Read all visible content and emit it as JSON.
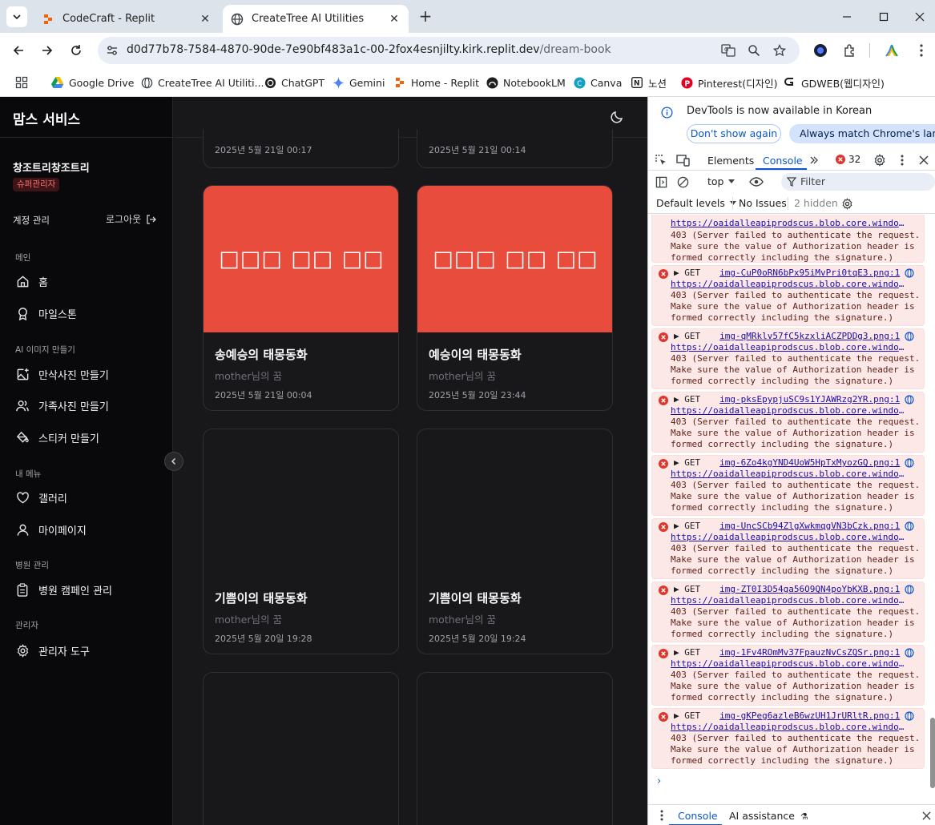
{
  "browser": {
    "tabs": [
      {
        "title": "CodeCraft - Replit",
        "active": false
      },
      {
        "title": "CreateTree AI Utilities",
        "active": true
      }
    ],
    "url_host": "d0d77b78-7584-4870-90de-7e90bf483a1c-00-2fox4esnjilty.kirk.replit.dev",
    "url_path": "/dream-book",
    "bookmarks": [
      "Google Drive",
      "CreateTree AI Utiliti...",
      "ChatGPT",
      "Gemini",
      "Home - Replit",
      "NotebookLM",
      "Canva",
      "노션",
      "Pinterest(디자인)",
      "GDWEB(웹디자인)"
    ]
  },
  "sidebar": {
    "brand": "맘스 서비스",
    "user_name": "창조트리창조트리",
    "role_badge": "슈퍼관리자",
    "account_label": "계정 관리",
    "logout_label": "로그아웃",
    "sections": {
      "main": "메인",
      "ai": "AI 이미지 만들기",
      "my": "내 메뉴",
      "hospital": "병원 관리",
      "admin": "관리자"
    },
    "items": {
      "home": "홈",
      "milestone": "마일스톤",
      "maternity": "만삭사진 만들기",
      "family": "가족사진 만들기",
      "sticker": "스티커 만들기",
      "gallery": "갤러리",
      "mypage": "마이페이지",
      "campaign": "병원 캠페인 관리",
      "admin_tools": "관리자 도구"
    }
  },
  "cards": {
    "top_left_date": "2025년 5월 21일 00:17",
    "top_right_date": "2025년 5월 21일 00:14",
    "items": [
      {
        "image_text": "□□□ □□ □□",
        "title": "송예승의 태몽동화",
        "subtitle": "mother님의 꿈",
        "date": "2025년 5월 21일 00:04"
      },
      {
        "image_text": "□□□ □□ □□",
        "title": "예승이의 태몽동화",
        "subtitle": "mother님의 꿈",
        "date": "2025년 5월 20일 23:44"
      },
      {
        "title": "기쁨이의 태몽동화",
        "subtitle": "mother님의 꿈",
        "date": "2025년 5월 20일 19:28"
      },
      {
        "title": "기쁨이의 태몽동화",
        "subtitle": "mother님의 꿈",
        "date": "2025년 5월 20일 19:24"
      }
    ],
    "image_color": "#e74c3c"
  },
  "devtools": {
    "info_message": "DevTools is now available in Korean",
    "dont_show": "Don't show again",
    "always_match": "Always match Chrome's language",
    "tab_elements": "Elements",
    "tab_console": "Console",
    "error_count": "32",
    "context": "top",
    "filter_placeholder": "Filter",
    "default_levels": "Default levels",
    "no_issues": "No Issues",
    "hidden": "2 hidden",
    "bottom_console": "Console",
    "bottom_ai": "AI assistance",
    "partial_entry": {
      "url": "https://oaidalleapiprodscus.blob.core.windows.n…",
      "msg1": "403 (Server failed to authenticate the request.",
      "msg2": "Make sure the value of Authorization header is",
      "msg3": "formed correctly including the signature.)"
    },
    "entries": [
      {
        "method": "▶ GET",
        "file": "img-CuP0oRN6bPx95iMvPri0tqE3.png:1",
        "url": "https://oaidalleapiprodscus.blob.core.windows.n…",
        "msg1": "403 (Server failed to authenticate the request.",
        "msg2": "Make sure the value of Authorization header is",
        "msg3": "formed correctly including the signature.)"
      },
      {
        "method": "▶ GET",
        "file": "img-qMRklv57fC5kzxliACZPDDg3.png:1",
        "url": "https://oaidalleapiprodscus.blob.core.windows.n…",
        "msg1": "403 (Server failed to authenticate the request.",
        "msg2": "Make sure the value of Authorization header is",
        "msg3": "formed correctly including the signature.)"
      },
      {
        "method": "▶ GET",
        "file": "img-pksEpypjuSC9s1YJAWRzg2YR.png:1",
        "url": "https://oaidalleapiprodscus.blob.core.windows.n…",
        "msg1": "403 (Server failed to authenticate the request.",
        "msg2": "Make sure the value of Authorization header is",
        "msg3": "formed correctly including the signature.)"
      },
      {
        "method": "▶ GET",
        "file": "img-6Zo4kgYND4UoW5HpTxMyozGQ.png:1",
        "url": "https://oaidalleapiprodscus.blob.core.windows.n…",
        "msg1": "403 (Server failed to authenticate the request.",
        "msg2": "Make sure the value of Authorization header is",
        "msg3": "formed correctly including the signature.)"
      },
      {
        "method": "▶ GET",
        "file": "img-UncSCb94ZlgXwkmqgVN3bCzk.png:1",
        "url": "https://oaidalleapiprodscus.blob.core.windows.n…",
        "msg1": "403 (Server failed to authenticate the request.",
        "msg2": "Make sure the value of Authorization header is",
        "msg3": "formed correctly including the signature.)"
      },
      {
        "method": "▶ GET",
        "file": "img-ZT0I3D54ga56O9QN4poYbKXB.png:1",
        "url": "https://oaidalleapiprodscus.blob.core.windows.n…",
        "msg1": "403 (Server failed to authenticate the request.",
        "msg2": "Make sure the value of Authorization header is",
        "msg3": "formed correctly including the signature.)"
      },
      {
        "method": "▶ GET",
        "file": "img-1Fv4ROmMv37FpauzNvCsZQSr.png:1",
        "url": "https://oaidalleapiprodscus.blob.core.windows.n…",
        "msg1": "403 (Server failed to authenticate the request.",
        "msg2": "Make sure the value of Authorization header is",
        "msg3": "formed correctly including the signature.)"
      },
      {
        "method": "▶ GET",
        "file": "img-gKPeg6azleB6wzUH1JrURltR.png:1",
        "url": "https://oaidalleapiprodscus.blob.core.windows.n…",
        "msg1": "403 (Server failed to authenticate the request.",
        "msg2": "Make sure the value of Authorization header is",
        "msg3": "formed correctly including the signature.)"
      }
    ]
  }
}
